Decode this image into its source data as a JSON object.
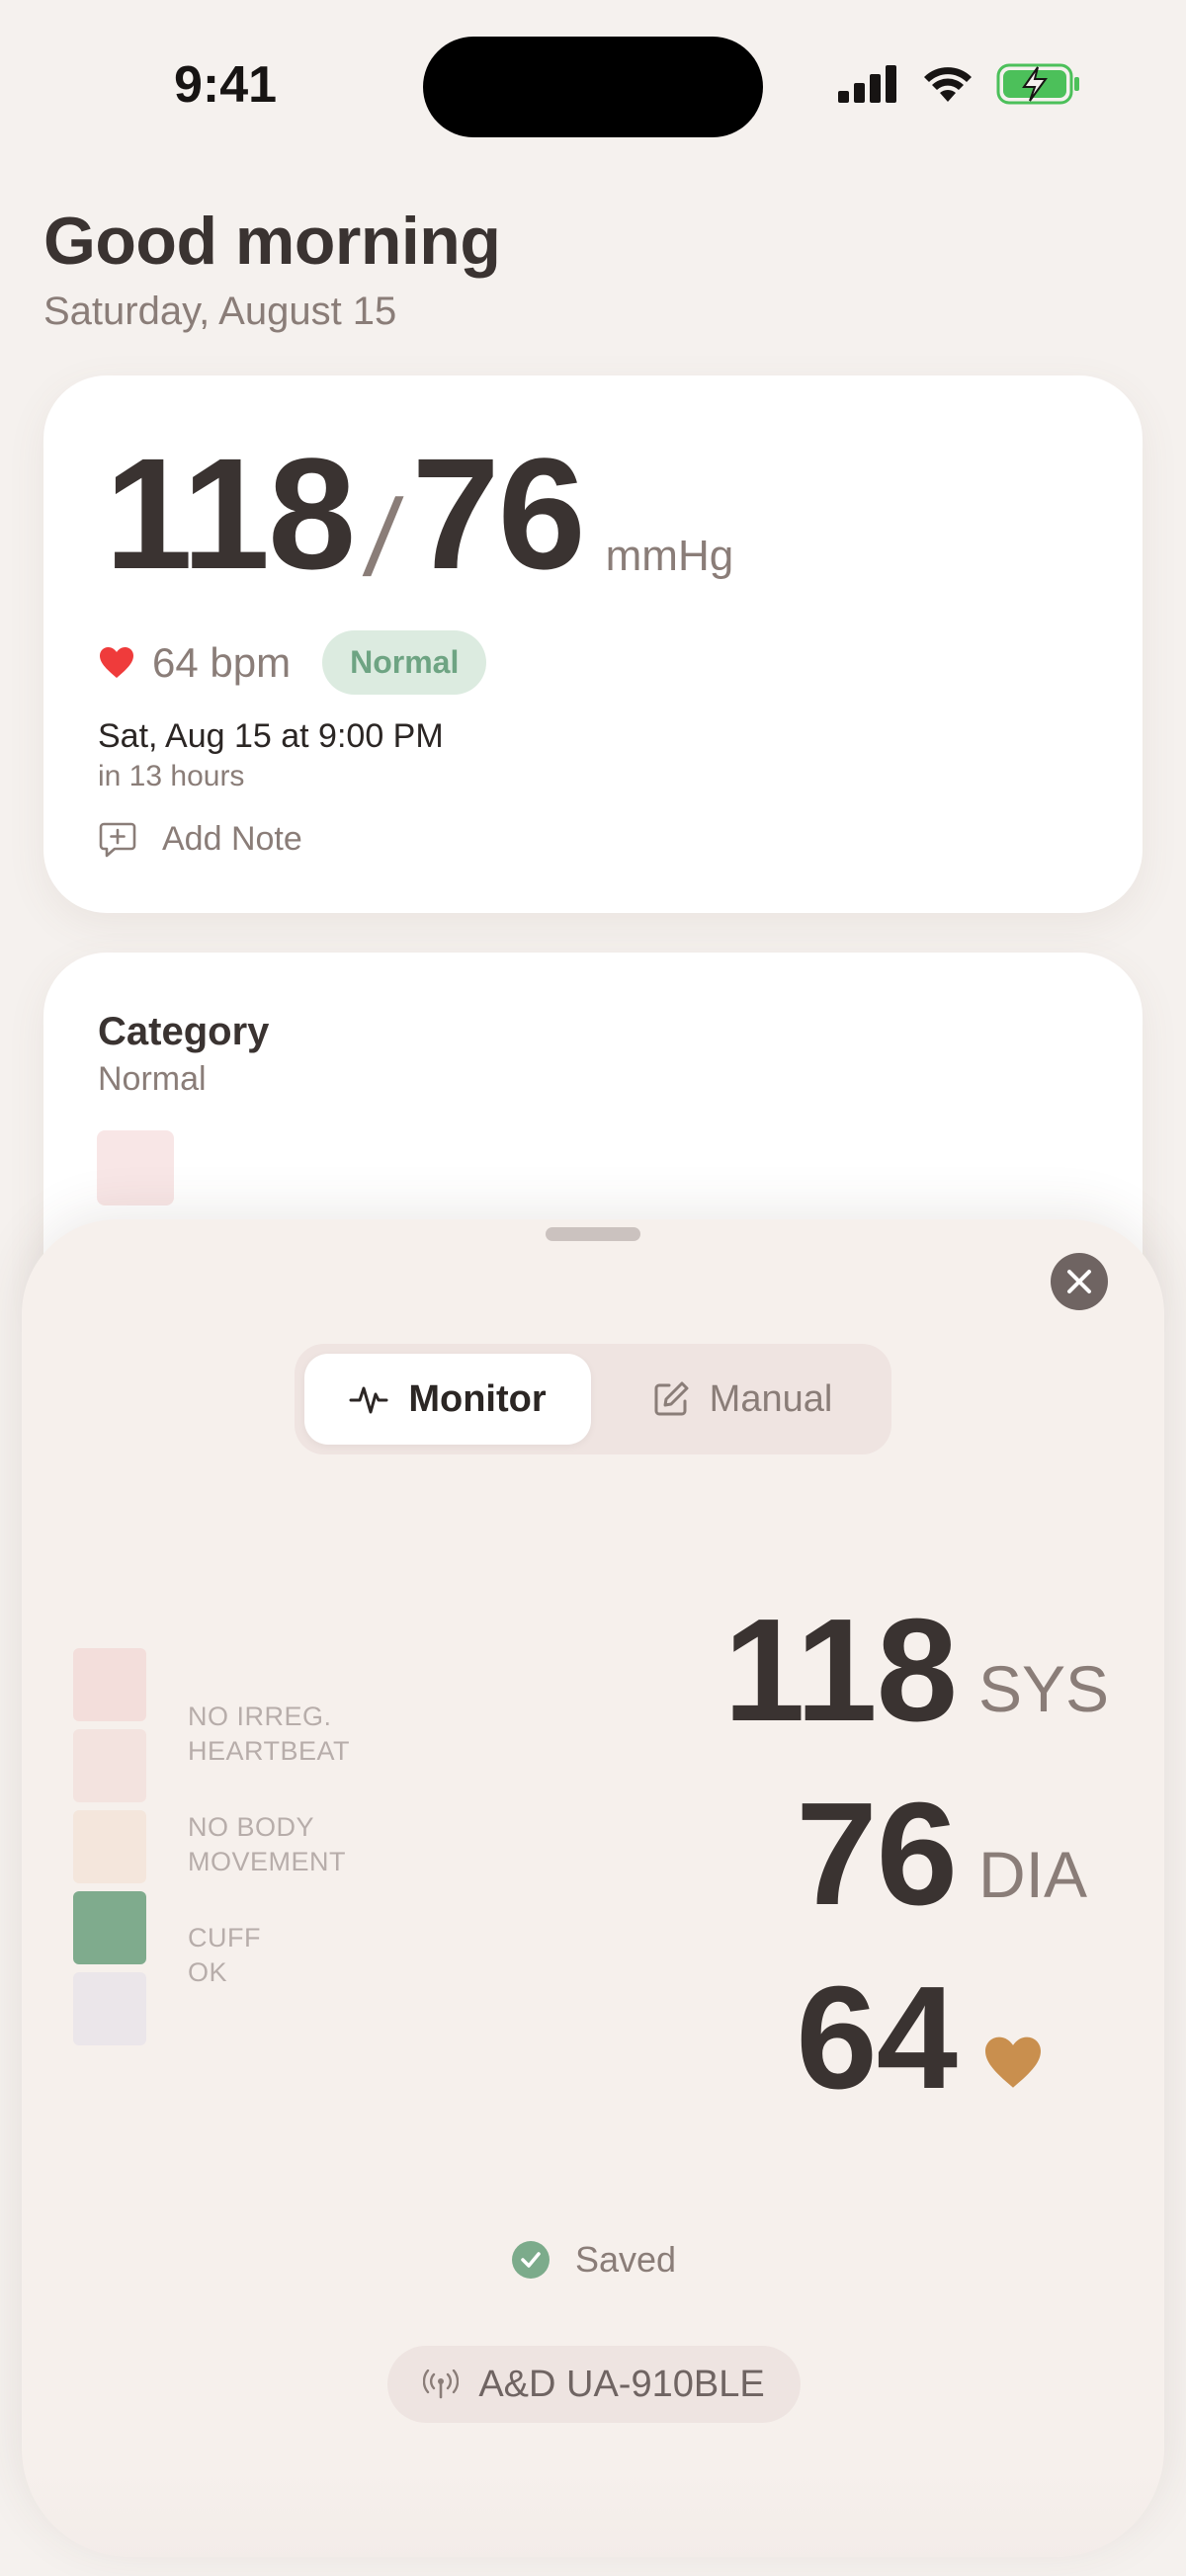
{
  "status_bar": {
    "time": "9:41"
  },
  "header": {
    "greeting": "Good morning",
    "date": "Saturday, August 15"
  },
  "reading_card": {
    "systolic": "118",
    "slash": "/",
    "diastolic": "76",
    "unit": "mmHg",
    "pulse": "64 bpm",
    "status": "Normal",
    "scheduled": "Sat, Aug 15 at 9:00 PM",
    "relative": "in 13 hours",
    "add_note": "Add Note"
  },
  "category_card": {
    "title": "Category",
    "value": "Normal"
  },
  "sheet": {
    "tabs": {
      "monitor": "Monitor",
      "manual": "Manual",
      "selected": "Monitor"
    },
    "indicators": [
      {
        "label": "NO IRREG.\nHEARTBEAT",
        "color": "#f3dedb"
      },
      {
        "label": "NO BODY\nMOVEMENT",
        "color": "#f4e2dd"
      },
      {
        "label": "CUFF\nOK",
        "color": "#7fab8d"
      }
    ],
    "indicator_square_colors": [
      "#f3dedb",
      "#f3e3df",
      "#f4e6dc",
      "#7fab8d",
      "#ebe6ea"
    ],
    "systolic": "118",
    "sys_label": "SYS",
    "diastolic": "76",
    "dia_label": "DIA",
    "pulse": "64",
    "saved": "Saved",
    "device": "A&D UA-910BLE"
  },
  "colors": {
    "heart": "#ef3b3b",
    "pulse_heart": "#c98f4e",
    "normal_pill_bg": "#dcebe0",
    "normal_pill_text": "#6ea483",
    "battery": "#4cc05a"
  },
  "icons": [
    "signal-icon",
    "wifi-icon",
    "battery-charging-icon",
    "heart-icon",
    "add-note-icon",
    "close-icon",
    "waveform-icon",
    "edit-icon",
    "check-icon",
    "antenna-icon"
  ]
}
